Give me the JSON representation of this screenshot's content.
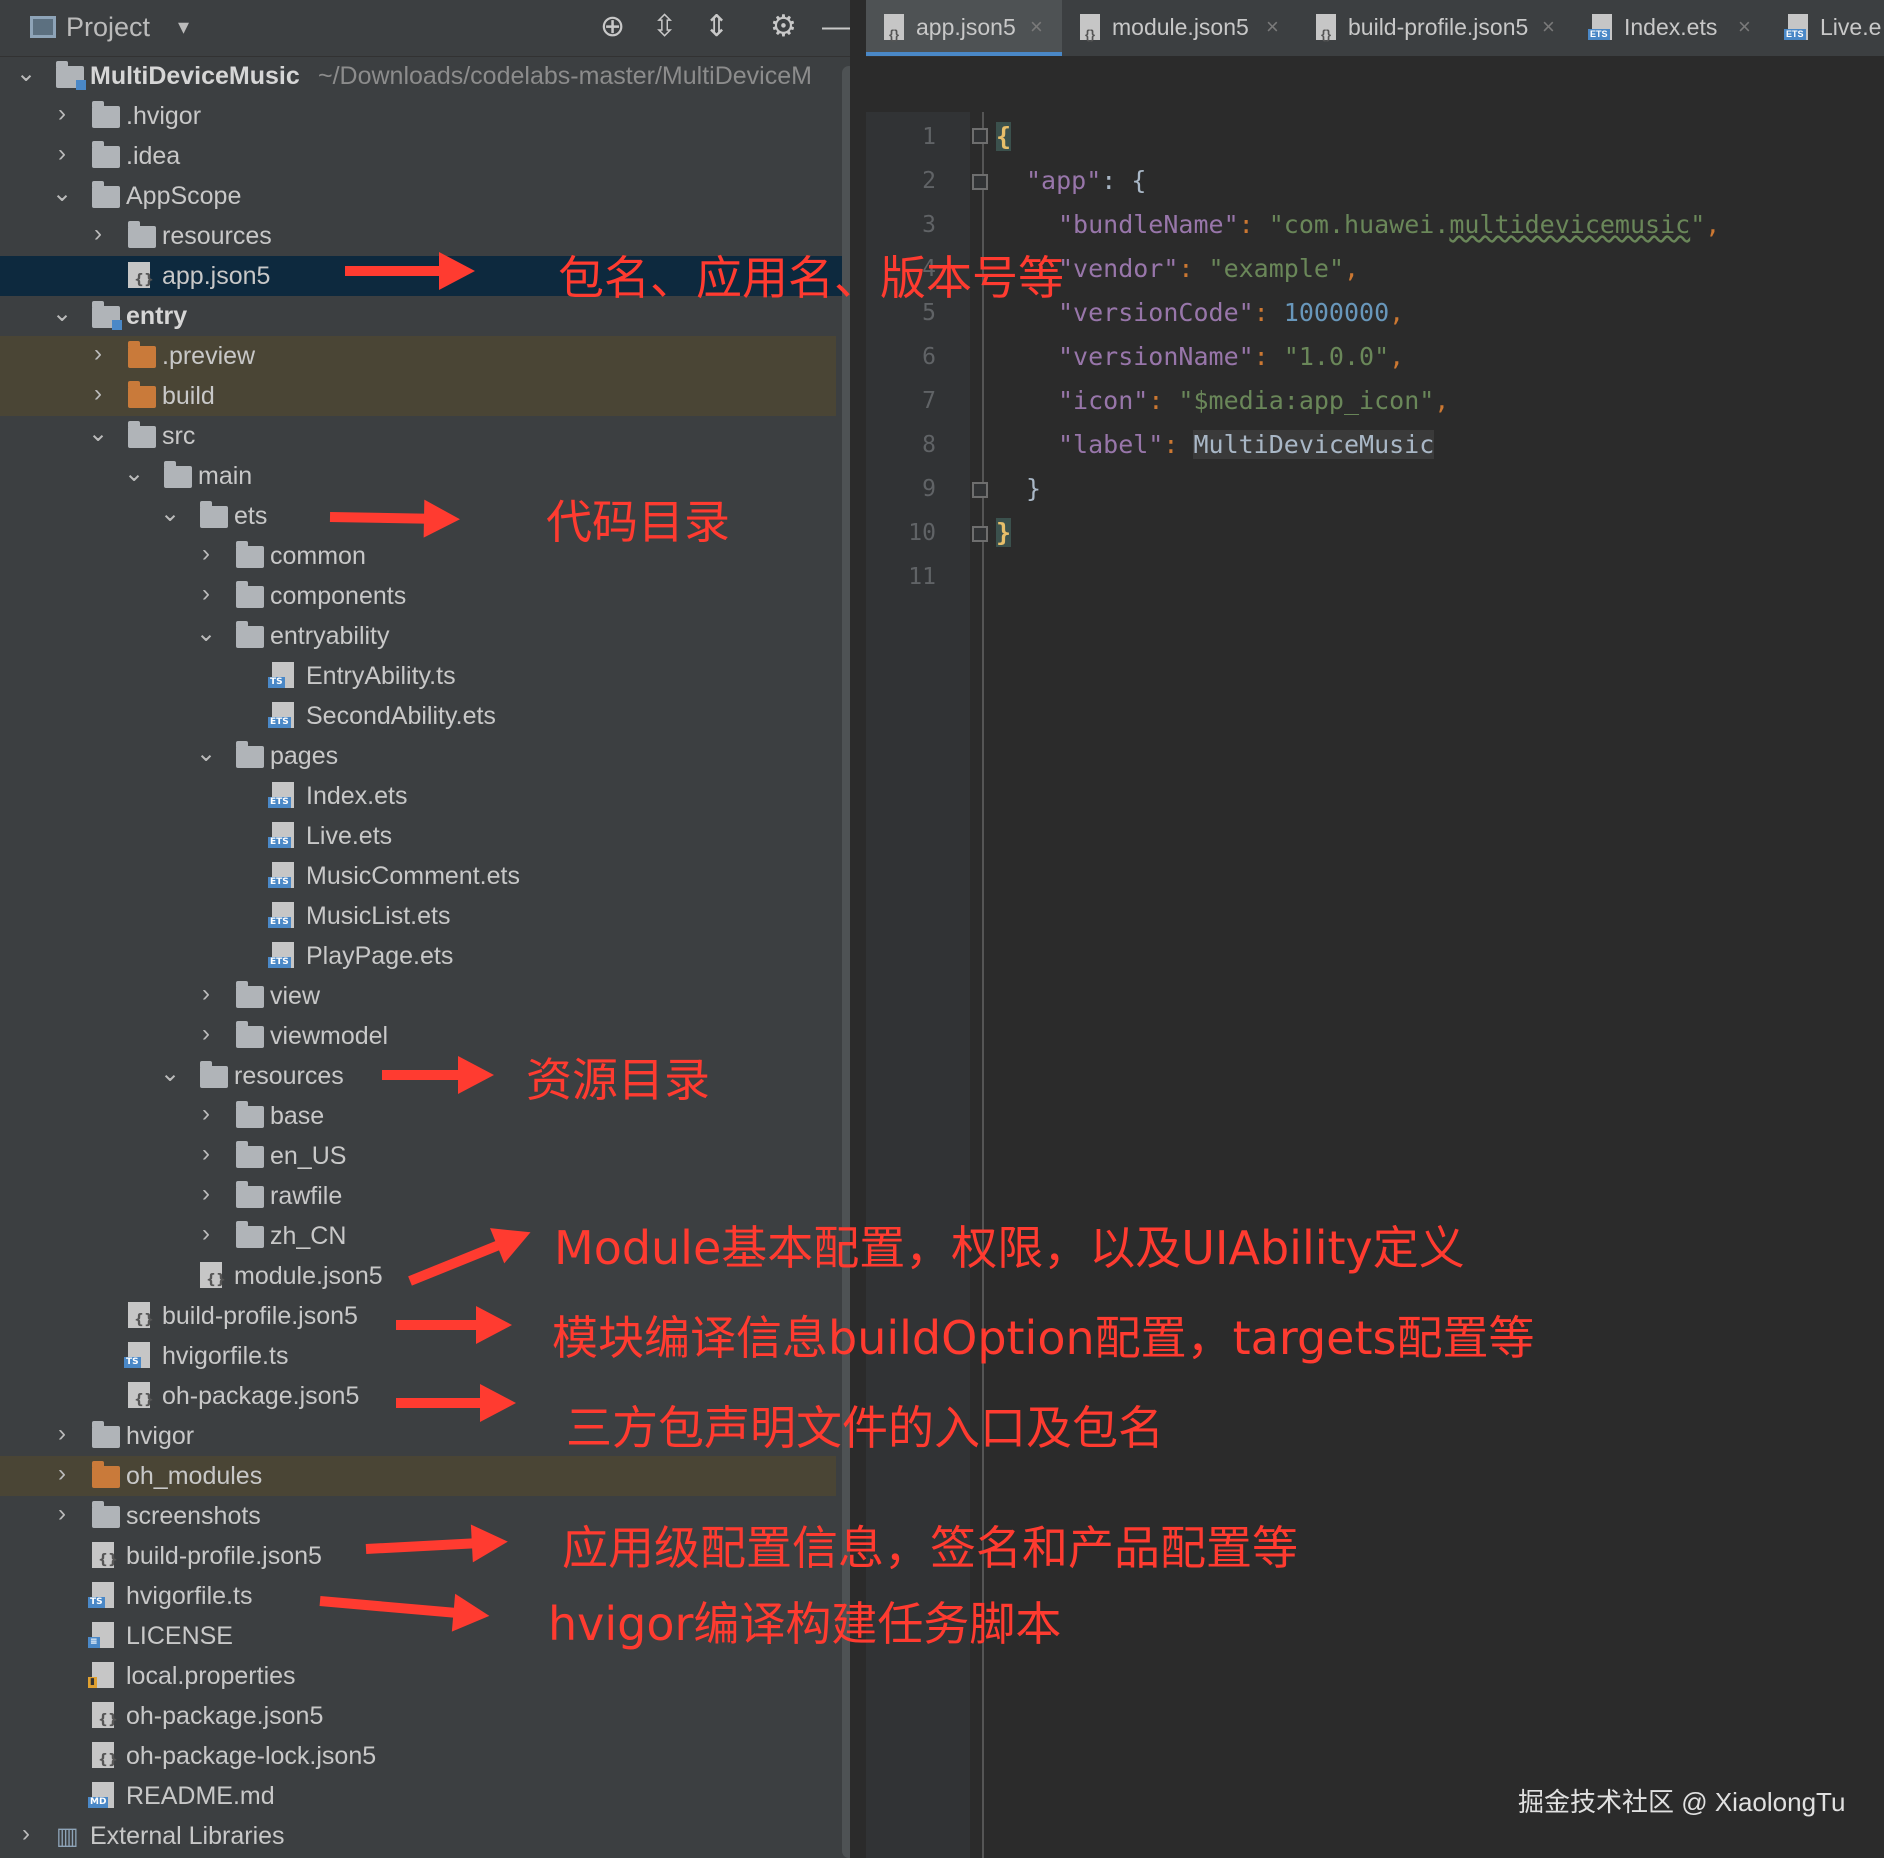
{
  "project_panel": {
    "title": "Project",
    "root_name": "MultiDeviceMusic",
    "root_path": "~/Downloads/codelabs-master/MultiDeviceM",
    "tree": [
      {
        "label": ".hvigor",
        "level": 1,
        "type": "folder",
        "arrow": "›"
      },
      {
        "label": ".idea",
        "level": 1,
        "type": "folder",
        "arrow": "›"
      },
      {
        "label": "AppScope",
        "level": 1,
        "type": "folder",
        "arrow": "⌄"
      },
      {
        "label": "resources",
        "level": 2,
        "type": "folder",
        "arrow": "›"
      },
      {
        "label": "app.json5",
        "level": 2,
        "type": "json",
        "arrow": ""
      },
      {
        "label": "entry",
        "level": 1,
        "type": "module",
        "arrow": "⌄"
      },
      {
        "label": ".preview",
        "level": 2,
        "type": "orange",
        "arrow": "›"
      },
      {
        "label": "build",
        "level": 2,
        "type": "orange",
        "arrow": "›"
      },
      {
        "label": "src",
        "level": 2,
        "type": "folder",
        "arrow": "⌄"
      },
      {
        "label": "main",
        "level": 3,
        "type": "folder",
        "arrow": "⌄"
      },
      {
        "label": "ets",
        "level": 4,
        "type": "folder",
        "arrow": "⌄"
      },
      {
        "label": "common",
        "level": 5,
        "type": "folder",
        "arrow": "›"
      },
      {
        "label": "components",
        "level": 5,
        "type": "folder",
        "arrow": "›"
      },
      {
        "label": "entryability",
        "level": 5,
        "type": "folder",
        "arrow": "⌄"
      },
      {
        "label": "EntryAbility.ts",
        "level": 6,
        "type": "ts",
        "arrow": ""
      },
      {
        "label": "SecondAbility.ets",
        "level": 6,
        "type": "ets",
        "arrow": ""
      },
      {
        "label": "pages",
        "level": 5,
        "type": "folder",
        "arrow": "⌄"
      },
      {
        "label": "Index.ets",
        "level": 6,
        "type": "ets",
        "arrow": ""
      },
      {
        "label": "Live.ets",
        "level": 6,
        "type": "ets",
        "arrow": ""
      },
      {
        "label": "MusicComment.ets",
        "level": 6,
        "type": "ets",
        "arrow": ""
      },
      {
        "label": "MusicList.ets",
        "level": 6,
        "type": "ets",
        "arrow": ""
      },
      {
        "label": "PlayPage.ets",
        "level": 6,
        "type": "ets",
        "arrow": ""
      },
      {
        "label": "view",
        "level": 5,
        "type": "folder",
        "arrow": "›"
      },
      {
        "label": "viewmodel",
        "level": 5,
        "type": "folder",
        "arrow": "›"
      },
      {
        "label": "resources",
        "level": 4,
        "type": "folder",
        "arrow": "⌄"
      },
      {
        "label": "base",
        "level": 5,
        "type": "folder",
        "arrow": "›"
      },
      {
        "label": "en_US",
        "level": 5,
        "type": "folder",
        "arrow": "›"
      },
      {
        "label": "rawfile",
        "level": 5,
        "type": "folder",
        "arrow": "›"
      },
      {
        "label": "zh_CN",
        "level": 5,
        "type": "folder",
        "arrow": "›"
      },
      {
        "label": "module.json5",
        "level": 4,
        "type": "json",
        "arrow": ""
      },
      {
        "label": "build-profile.json5",
        "level": 2,
        "type": "json",
        "arrow": ""
      },
      {
        "label": "hvigorfile.ts",
        "level": 2,
        "type": "ts",
        "arrow": ""
      },
      {
        "label": "oh-package.json5",
        "level": 2,
        "type": "json",
        "arrow": ""
      },
      {
        "label": "hvigor",
        "level": 1,
        "type": "folder",
        "arrow": "›"
      },
      {
        "label": "oh_modules",
        "level": 1,
        "type": "orange",
        "arrow": "›"
      },
      {
        "label": "screenshots",
        "level": 1,
        "type": "folder",
        "arrow": "›"
      },
      {
        "label": "build-profile.json5",
        "level": 1,
        "type": "json",
        "arrow": ""
      },
      {
        "label": "hvigorfile.ts",
        "level": 1,
        "type": "ts",
        "arrow": ""
      },
      {
        "label": "LICENSE",
        "level": 1,
        "type": "license",
        "arrow": ""
      },
      {
        "label": "local.properties",
        "level": 1,
        "type": "props",
        "arrow": ""
      },
      {
        "label": "oh-package.json5",
        "level": 1,
        "type": "json",
        "arrow": ""
      },
      {
        "label": "oh-package-lock.json5",
        "level": 1,
        "type": "json",
        "arrow": ""
      },
      {
        "label": "README.md",
        "level": 1,
        "type": "md",
        "arrow": ""
      },
      {
        "label": "External Libraries",
        "level": 0,
        "type": "libs",
        "arrow": "›"
      }
    ]
  },
  "tabs": [
    {
      "label": "app.json5",
      "badge": "{}",
      "active": true
    },
    {
      "label": "module.json5",
      "badge": "{}",
      "active": false
    },
    {
      "label": "build-profile.json5",
      "badge": "{}",
      "active": false
    },
    {
      "label": "Index.ets",
      "badge": "ETS",
      "active": false
    },
    {
      "label": "Live.e",
      "badge": "ETS",
      "active": false
    }
  ],
  "editor": {
    "line_numbers": [
      "1",
      "2",
      "3",
      "4",
      "5",
      "6",
      "7",
      "8",
      "9",
      "10",
      "11"
    ],
    "code": {
      "l1": "{",
      "l2_key": "\"app\"",
      "l2_rest": ": {",
      "l3_key": "\"bundleName\"",
      "l3_val_a": "\"com.huawei.",
      "l3_val_b": "multidevicemusic",
      "l3_val_c": "\"",
      "l4_key": "\"vendor\"",
      "l4_val": "\"example\"",
      "l5_key": "\"versionCode\"",
      "l5_val": "1000000",
      "l6_key": "\"versionName\"",
      "l6_val": "\"1.0.0\"",
      "l7_key": "\"icon\"",
      "l7_val": "\"$media:app_icon\"",
      "l8_key": "\"label\"",
      "l8_val": "MultiDeviceMusic",
      "l9": "}",
      "l10": "}",
      "colon": ": ",
      "comma": ","
    }
  },
  "annotations": {
    "app_json": "包名、应用名、版本号等",
    "ets": "代码目录",
    "resources": "资源目录",
    "module_json": "Module基本配置，权限，以及UIAbility定义",
    "build_profile_module": "模块编译信息buildOption配置，targets配置等",
    "oh_package_module": "三方包声明文件的入口及包名",
    "build_profile_app": "应用级配置信息，签名和产品配置等",
    "hvigorfile": "hvigor编译构建任务脚本"
  },
  "watermark": "掘金技术社区 @ XiaolongTu",
  "colors": {
    "annotation": "#ff3b30",
    "panel_bg": "#3c3f41",
    "editor_bg": "#2b2b2b",
    "selection": "#0d293e"
  }
}
